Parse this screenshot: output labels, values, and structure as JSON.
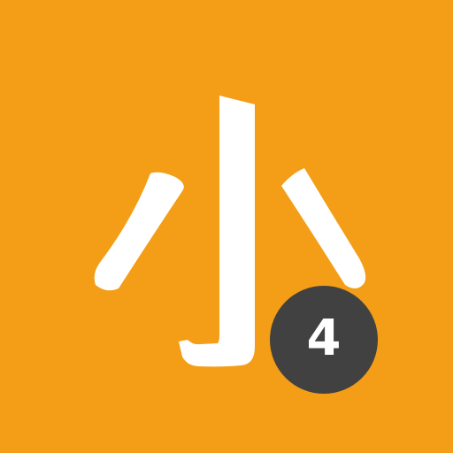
{
  "app_icon": {
    "glyph": "小",
    "badge_number": "4",
    "colors": {
      "background": "#F39E16",
      "glyph": "#FFFFFF",
      "badge": "#414141",
      "badge_text": "#FFFFFF"
    }
  }
}
